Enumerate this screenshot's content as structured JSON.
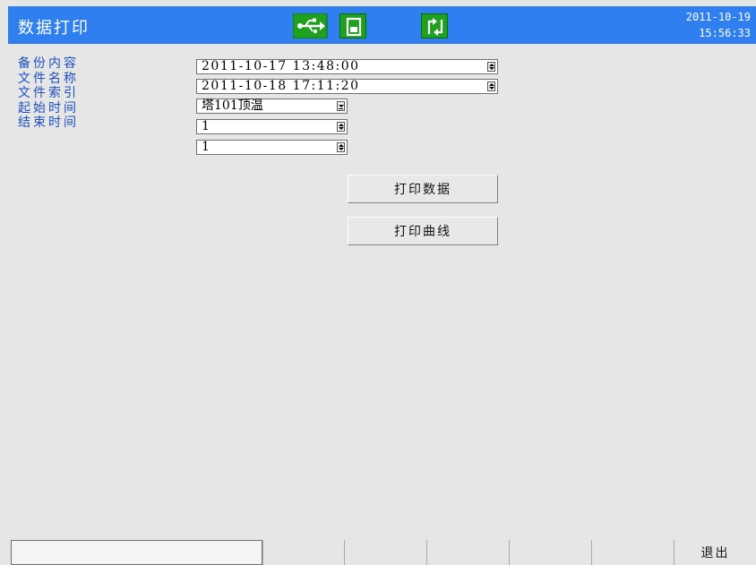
{
  "header": {
    "title": "数据打印",
    "date": "2011-10-19",
    "time": "15:56:33",
    "icons": [
      "usb-icon",
      "sd-card-icon",
      "refresh-icon"
    ],
    "bar_color": "#2f7ff0",
    "icon_color": "#1fa01f"
  },
  "form": {
    "labels": [
      "备份内容",
      "文件名称",
      "文件索引",
      "起始时间",
      "结束时间"
    ],
    "backup_content": "2011-10-17 13:48:00",
    "file_name": "2011-10-18 17:11:20",
    "file_index": "塔101顶温",
    "start_time": "1",
    "end_time": "1"
  },
  "buttons": {
    "print_data": "打印数据",
    "print_curve": "打印曲线"
  },
  "bottom_bar": {
    "status_text": "",
    "softkeys": [
      "",
      "",
      "",
      "",
      "",
      ""
    ],
    "exit_label": "退出"
  }
}
